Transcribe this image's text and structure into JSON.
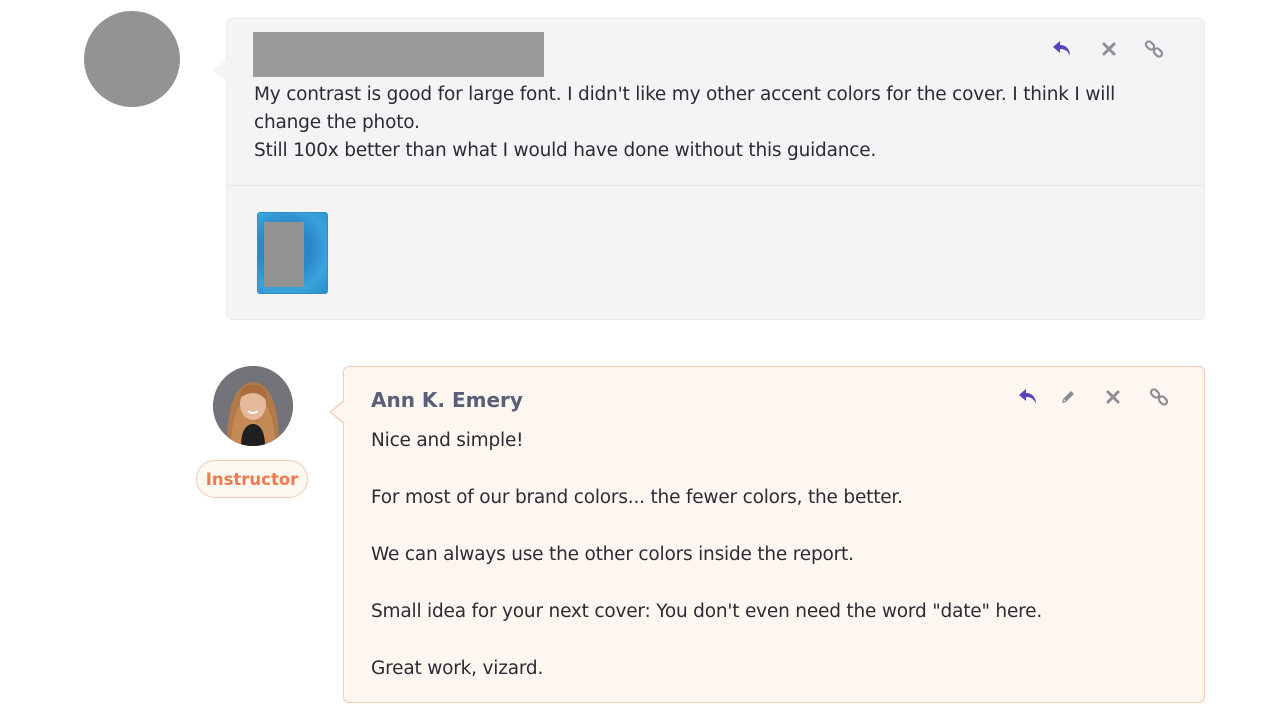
{
  "student_comment": {
    "body_lines": [
      "My contrast is good for large font.  I didn't like my other accent colors for the cover.  I think I will  change the photo.",
      "Still 100x better than what I would have done without this guidance."
    ],
    "actions": [
      "reply-icon",
      "delete-icon",
      "link-icon"
    ]
  },
  "instructor_comment": {
    "author": "Ann K. Emery",
    "role_badge": "Instructor",
    "paragraphs": [
      "Nice and simple!",
      "For most of our brand colors... the fewer colors, the better.",
      "We can always use the other colors inside the report.",
      "Small idea for your next cover: You don't even need the word \"date\" here.",
      "Great work, vizard."
    ],
    "actions": [
      "reply-icon",
      "edit-icon",
      "delete-icon",
      "link-icon"
    ]
  },
  "colors": {
    "accent_purple": "#5b3fc4",
    "icon_gray": "#8e8e96",
    "badge_orange": "#ee7a4f"
  }
}
